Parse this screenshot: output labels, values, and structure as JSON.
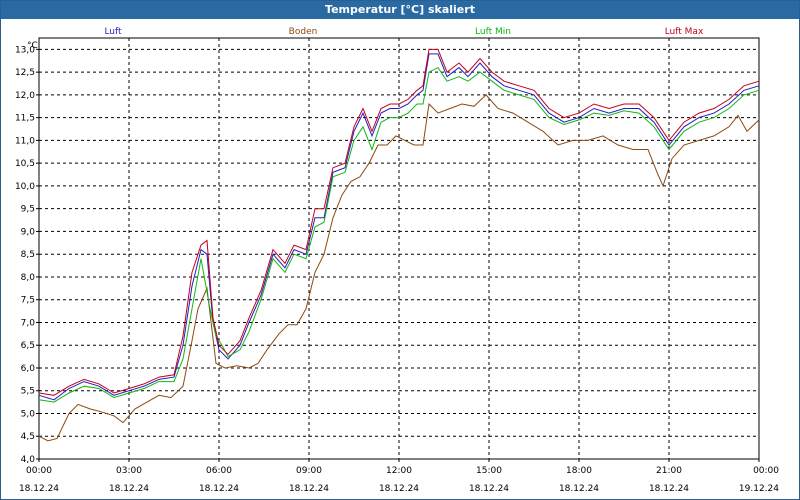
{
  "window": {
    "title": "Temperatur [°C] skaliert"
  },
  "chart_data": {
    "type": "line",
    "title": "Temperatur [°C] skaliert",
    "ylabel": "°C",
    "ylim": [
      4.0,
      13.25
    ],
    "yticks": [
      "4,0",
      "4,5",
      "5,0",
      "5,5",
      "6,0",
      "6,5",
      "7,0",
      "7,5",
      "8,0",
      "8,5",
      "9,0",
      "9,5",
      "10,0",
      "10,5",
      "11,0",
      "11,5",
      "12,0",
      "12,5",
      "13,0"
    ],
    "xlim": [
      0,
      24
    ],
    "xticks": [
      {
        "time": "00:00",
        "date": "18.12.24"
      },
      {
        "time": "03:00",
        "date": "18.12.24"
      },
      {
        "time": "06:00",
        "date": "18.12.24"
      },
      {
        "time": "09:00",
        "date": "18.12.24"
      },
      {
        "time": "12:00",
        "date": "18.12.24"
      },
      {
        "time": "15:00",
        "date": "18.12.24"
      },
      {
        "time": "18:00",
        "date": "18.12.24"
      },
      {
        "time": "21:00",
        "date": "18.12.24"
      },
      {
        "time": "00:00",
        "date": "19.12.24"
      }
    ],
    "grid": true,
    "legend_position": "top",
    "series": [
      {
        "name": "Luft",
        "color": "#1f1fbf",
        "points": [
          [
            0,
            5.4
          ],
          [
            0.5,
            5.3
          ],
          [
            1.0,
            5.55
          ],
          [
            1.5,
            5.7
          ],
          [
            2.0,
            5.6
          ],
          [
            2.5,
            5.4
          ],
          [
            3.0,
            5.5
          ],
          [
            3.5,
            5.6
          ],
          [
            4.0,
            5.75
          ],
          [
            4.5,
            5.8
          ],
          [
            4.8,
            6.5
          ],
          [
            5.1,
            7.8
          ],
          [
            5.4,
            8.6
          ],
          [
            5.6,
            8.5
          ],
          [
            5.8,
            7.0
          ],
          [
            6.0,
            6.4
          ],
          [
            6.3,
            6.2
          ],
          [
            6.7,
            6.5
          ],
          [
            7.0,
            7.0
          ],
          [
            7.4,
            7.6
          ],
          [
            7.8,
            8.5
          ],
          [
            8.2,
            8.2
          ],
          [
            8.5,
            8.6
          ],
          [
            8.9,
            8.5
          ],
          [
            9.2,
            9.3
          ],
          [
            9.5,
            9.3
          ],
          [
            9.8,
            10.3
          ],
          [
            10.2,
            10.4
          ],
          [
            10.5,
            11.2
          ],
          [
            10.8,
            11.6
          ],
          [
            11.1,
            11.1
          ],
          [
            11.4,
            11.6
          ],
          [
            11.7,
            11.7
          ],
          [
            12.0,
            11.7
          ],
          [
            12.3,
            11.8
          ],
          [
            12.6,
            12.0
          ],
          [
            12.8,
            12.1
          ],
          [
            13.0,
            12.9
          ],
          [
            13.3,
            12.9
          ],
          [
            13.6,
            12.4
          ],
          [
            14.0,
            12.6
          ],
          [
            14.3,
            12.4
          ],
          [
            14.7,
            12.7
          ],
          [
            15.1,
            12.4
          ],
          [
            15.5,
            12.2
          ],
          [
            16.0,
            12.1
          ],
          [
            16.5,
            12.0
          ],
          [
            17.0,
            11.6
          ],
          [
            17.5,
            11.4
          ],
          [
            18.0,
            11.5
          ],
          [
            18.5,
            11.7
          ],
          [
            19.0,
            11.6
          ],
          [
            19.5,
            11.7
          ],
          [
            20.0,
            11.7
          ],
          [
            20.5,
            11.4
          ],
          [
            21.0,
            10.9
          ],
          [
            21.5,
            11.3
          ],
          [
            22.0,
            11.5
          ],
          [
            22.5,
            11.6
          ],
          [
            23.0,
            11.8
          ],
          [
            23.5,
            12.1
          ],
          [
            24.0,
            12.2
          ]
        ]
      },
      {
        "name": "Boden",
        "color": "#8b4a0e",
        "points": [
          [
            0,
            4.5
          ],
          [
            0.3,
            4.4
          ],
          [
            0.6,
            4.45
          ],
          [
            1.0,
            5.0
          ],
          [
            1.3,
            5.2
          ],
          [
            1.7,
            5.1
          ],
          [
            2.0,
            5.05
          ],
          [
            2.5,
            4.95
          ],
          [
            2.8,
            4.8
          ],
          [
            3.2,
            5.1
          ],
          [
            3.6,
            5.25
          ],
          [
            4.0,
            5.4
          ],
          [
            4.4,
            5.35
          ],
          [
            4.8,
            5.6
          ],
          [
            5.1,
            6.6
          ],
          [
            5.3,
            7.3
          ],
          [
            5.6,
            7.75
          ],
          [
            5.9,
            6.1
          ],
          [
            6.2,
            6.0
          ],
          [
            6.6,
            6.05
          ],
          [
            7.0,
            6.0
          ],
          [
            7.3,
            6.1
          ],
          [
            7.6,
            6.4
          ],
          [
            8.0,
            6.75
          ],
          [
            8.3,
            6.95
          ],
          [
            8.6,
            6.95
          ],
          [
            8.9,
            7.3
          ],
          [
            9.2,
            8.1
          ],
          [
            9.5,
            8.5
          ],
          [
            9.8,
            9.3
          ],
          [
            10.1,
            9.8
          ],
          [
            10.4,
            10.1
          ],
          [
            10.7,
            10.2
          ],
          [
            11.0,
            10.5
          ],
          [
            11.3,
            10.9
          ],
          [
            11.6,
            10.9
          ],
          [
            11.9,
            11.1
          ],
          [
            12.2,
            11.0
          ],
          [
            12.5,
            10.9
          ],
          [
            12.8,
            10.9
          ],
          [
            13.0,
            11.8
          ],
          [
            13.3,
            11.6
          ],
          [
            13.7,
            11.7
          ],
          [
            14.1,
            11.8
          ],
          [
            14.5,
            11.75
          ],
          [
            14.9,
            12.0
          ],
          [
            15.3,
            11.7
          ],
          [
            15.8,
            11.6
          ],
          [
            16.3,
            11.4
          ],
          [
            16.8,
            11.2
          ],
          [
            17.3,
            10.9
          ],
          [
            17.8,
            11.0
          ],
          [
            18.3,
            11.0
          ],
          [
            18.8,
            11.1
          ],
          [
            19.3,
            10.9
          ],
          [
            19.8,
            10.8
          ],
          [
            20.3,
            10.8
          ],
          [
            20.6,
            10.3
          ],
          [
            20.8,
            10.0
          ],
          [
            21.1,
            10.6
          ],
          [
            21.5,
            10.9
          ],
          [
            22.0,
            11.0
          ],
          [
            22.5,
            11.1
          ],
          [
            23.0,
            11.3
          ],
          [
            23.3,
            11.55
          ],
          [
            23.6,
            11.2
          ],
          [
            24.0,
            11.45
          ]
        ]
      },
      {
        "name": "Luft Min",
        "color": "#13b413",
        "points": [
          [
            0,
            5.3
          ],
          [
            0.5,
            5.25
          ],
          [
            1.0,
            5.45
          ],
          [
            1.5,
            5.6
          ],
          [
            2.0,
            5.55
          ],
          [
            2.5,
            5.35
          ],
          [
            3.0,
            5.45
          ],
          [
            3.5,
            5.55
          ],
          [
            4.0,
            5.7
          ],
          [
            4.5,
            5.7
          ],
          [
            4.8,
            6.2
          ],
          [
            5.1,
            7.3
          ],
          [
            5.4,
            8.4
          ],
          [
            5.7,
            7.3
          ],
          [
            5.9,
            6.7
          ],
          [
            6.1,
            6.5
          ],
          [
            6.3,
            6.25
          ],
          [
            6.7,
            6.4
          ],
          [
            7.0,
            6.8
          ],
          [
            7.4,
            7.5
          ],
          [
            7.8,
            8.4
          ],
          [
            8.2,
            8.1
          ],
          [
            8.5,
            8.5
          ],
          [
            8.9,
            8.4
          ],
          [
            9.2,
            9.1
          ],
          [
            9.5,
            9.2
          ],
          [
            9.8,
            10.2
          ],
          [
            10.2,
            10.3
          ],
          [
            10.5,
            11.0
          ],
          [
            10.8,
            11.3
          ],
          [
            11.1,
            10.8
          ],
          [
            11.4,
            11.4
          ],
          [
            11.7,
            11.5
          ],
          [
            12.0,
            11.5
          ],
          [
            12.3,
            11.6
          ],
          [
            12.6,
            11.8
          ],
          [
            12.8,
            11.8
          ],
          [
            13.0,
            12.5
          ],
          [
            13.3,
            12.6
          ],
          [
            13.6,
            12.3
          ],
          [
            14.0,
            12.4
          ],
          [
            14.3,
            12.3
          ],
          [
            14.7,
            12.5
          ],
          [
            15.1,
            12.3
          ],
          [
            15.5,
            12.1
          ],
          [
            16.0,
            12.0
          ],
          [
            16.5,
            11.9
          ],
          [
            17.0,
            11.5
          ],
          [
            17.5,
            11.35
          ],
          [
            18.0,
            11.45
          ],
          [
            18.5,
            11.6
          ],
          [
            19.0,
            11.55
          ],
          [
            19.5,
            11.65
          ],
          [
            20.0,
            11.6
          ],
          [
            20.5,
            11.3
          ],
          [
            21.0,
            10.8
          ],
          [
            21.5,
            11.2
          ],
          [
            22.0,
            11.4
          ],
          [
            22.5,
            11.5
          ],
          [
            23.0,
            11.7
          ],
          [
            23.5,
            12.0
          ],
          [
            24.0,
            12.1
          ]
        ]
      },
      {
        "name": "Luft Max",
        "color": "#c4001c",
        "points": [
          [
            0,
            5.45
          ],
          [
            0.5,
            5.4
          ],
          [
            1.0,
            5.6
          ],
          [
            1.5,
            5.75
          ],
          [
            2.0,
            5.65
          ],
          [
            2.5,
            5.45
          ],
          [
            3.0,
            5.55
          ],
          [
            3.5,
            5.65
          ],
          [
            4.0,
            5.8
          ],
          [
            4.5,
            5.85
          ],
          [
            4.8,
            6.7
          ],
          [
            5.1,
            8.1
          ],
          [
            5.4,
            8.7
          ],
          [
            5.6,
            8.8
          ],
          [
            5.8,
            7.1
          ],
          [
            6.0,
            6.5
          ],
          [
            6.3,
            6.3
          ],
          [
            6.7,
            6.6
          ],
          [
            7.0,
            7.1
          ],
          [
            7.4,
            7.7
          ],
          [
            7.8,
            8.6
          ],
          [
            8.2,
            8.3
          ],
          [
            8.5,
            8.7
          ],
          [
            8.9,
            8.6
          ],
          [
            9.2,
            9.5
          ],
          [
            9.5,
            9.5
          ],
          [
            9.8,
            10.4
          ],
          [
            10.2,
            10.5
          ],
          [
            10.5,
            11.3
          ],
          [
            10.8,
            11.7
          ],
          [
            11.1,
            11.2
          ],
          [
            11.4,
            11.7
          ],
          [
            11.7,
            11.8
          ],
          [
            12.0,
            11.8
          ],
          [
            12.3,
            11.9
          ],
          [
            12.6,
            12.1
          ],
          [
            12.8,
            12.2
          ],
          [
            13.0,
            13.0
          ],
          [
            13.3,
            13.0
          ],
          [
            13.6,
            12.5
          ],
          [
            14.0,
            12.7
          ],
          [
            14.3,
            12.5
          ],
          [
            14.7,
            12.8
          ],
          [
            15.1,
            12.5
          ],
          [
            15.5,
            12.3
          ],
          [
            16.0,
            12.2
          ],
          [
            16.5,
            12.1
          ],
          [
            17.0,
            11.7
          ],
          [
            17.5,
            11.5
          ],
          [
            18.0,
            11.6
          ],
          [
            18.5,
            11.8
          ],
          [
            19.0,
            11.7
          ],
          [
            19.5,
            11.8
          ],
          [
            20.0,
            11.8
          ],
          [
            20.5,
            11.5
          ],
          [
            21.0,
            11.0
          ],
          [
            21.5,
            11.4
          ],
          [
            22.0,
            11.6
          ],
          [
            22.5,
            11.7
          ],
          [
            23.0,
            11.9
          ],
          [
            23.5,
            12.2
          ],
          [
            24.0,
            12.3
          ]
        ]
      }
    ]
  }
}
